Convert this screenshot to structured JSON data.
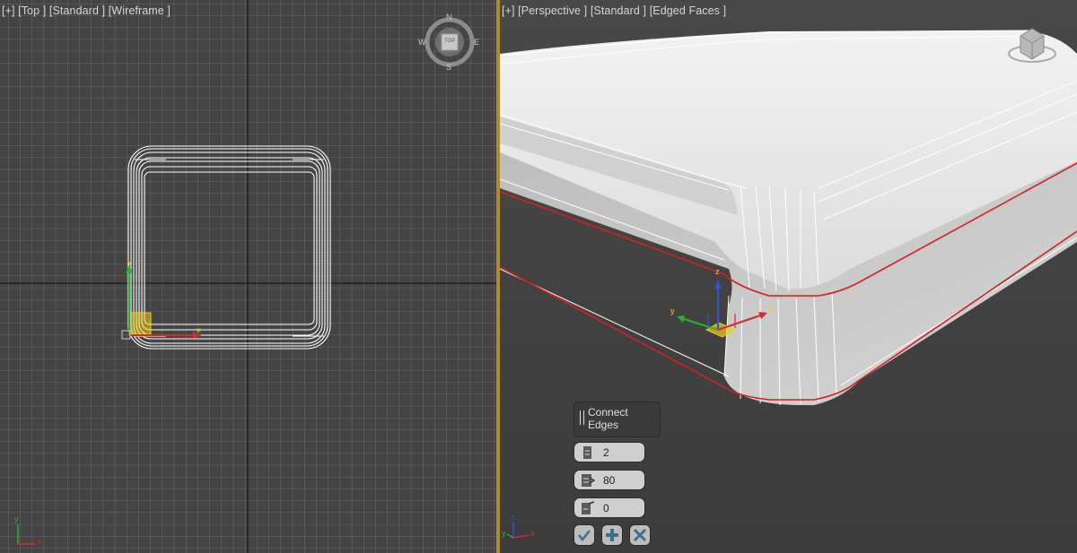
{
  "viewport_top": {
    "label_parts": [
      "[+]",
      "[Top ]",
      "[Standard ]",
      "[Wireframe ]"
    ],
    "compass": {
      "n": "N",
      "s": "S",
      "e": "E",
      "w": "W",
      "center": "TOP"
    },
    "gizmo_axis": {
      "x": "x",
      "y": "y"
    },
    "corner_axis": {
      "x": "x",
      "y": "y"
    }
  },
  "viewport_persp": {
    "label_parts": [
      "[+]",
      "[Perspective ]",
      "[Standard ]",
      "[Edged Faces ]"
    ],
    "gizmo_axis": {
      "x": "x",
      "y": "y",
      "z": "z"
    },
    "corner_axis": {
      "x": "x",
      "y": "y",
      "z": "z"
    }
  },
  "caddy": {
    "title": "Connect Edges",
    "segments": "2",
    "pinch": "80",
    "slide": "0",
    "ok_icon": "check-icon",
    "apply_icon": "plus-icon",
    "cancel_icon": "x-icon"
  },
  "colors": {
    "selection_edge": "#d42020",
    "grid_bg": "#444444",
    "active_border": "#b08a2c",
    "axis_x": "#d62b2b",
    "axis_y": "#2fae3a",
    "axis_z": "#2f55c8",
    "gizmo_plane": "#f0d020"
  }
}
